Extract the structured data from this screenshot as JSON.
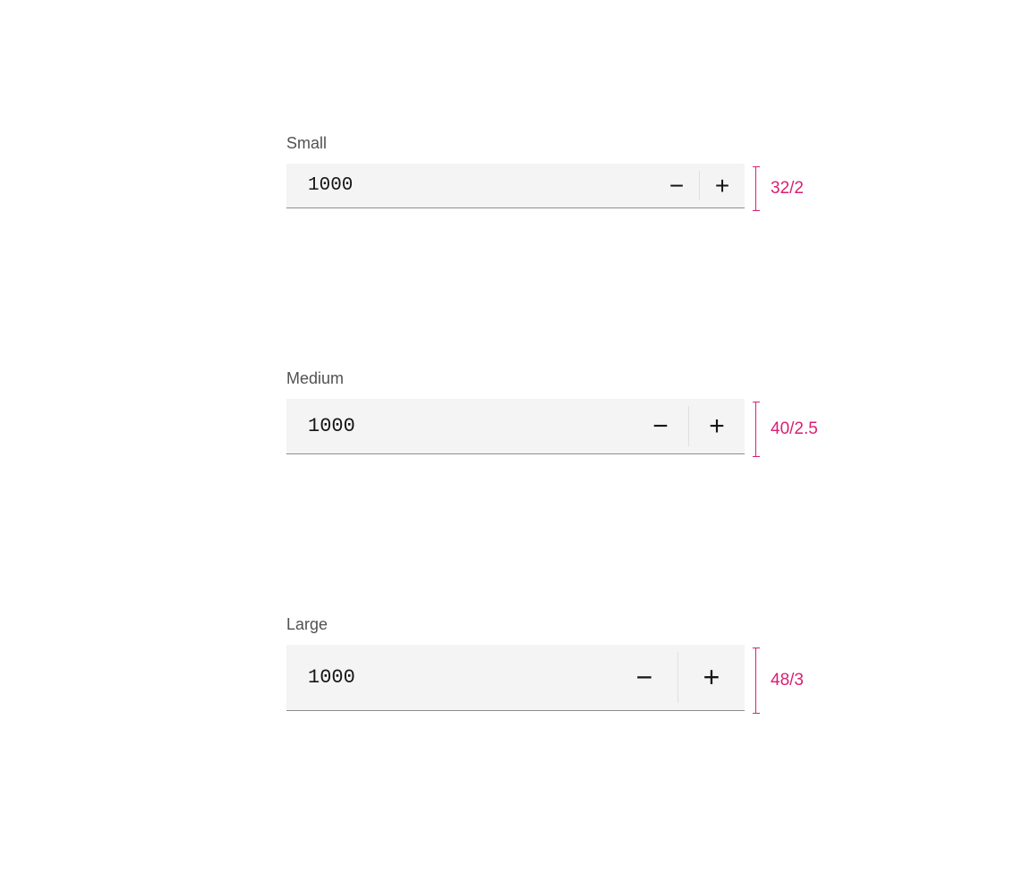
{
  "variants": {
    "small": {
      "label": "Small",
      "value": "1000",
      "dimension": "32/2"
    },
    "medium": {
      "label": "Medium",
      "value": "1000",
      "dimension": "40/2.5"
    },
    "large": {
      "label": "Large",
      "value": "1000",
      "dimension": "48/3"
    }
  },
  "icons": {
    "minus": "−",
    "plus": "+"
  },
  "colors": {
    "accent": "#da1e72",
    "field_bg": "#f4f4f4",
    "text_primary": "#161616",
    "text_secondary": "#525252",
    "border": "#8d8d8d"
  }
}
